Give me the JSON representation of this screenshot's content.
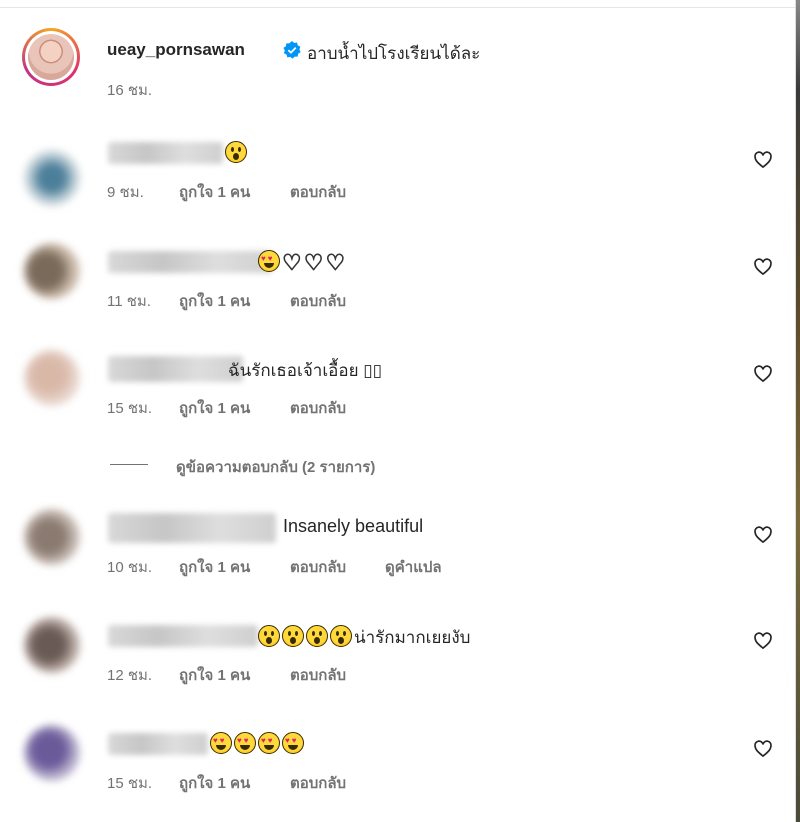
{
  "caption": {
    "username": "ueay_pornsawan",
    "text": "อาบน้ำไปโรงเรียนได้ละ",
    "time": "16 ชม."
  },
  "actions": {
    "like_count": "ถูกใจ 1 คน",
    "reply": "ตอบกลับ",
    "translate": "ดูคำแปล"
  },
  "comments": [
    {
      "text": "",
      "emoji": [
        "wow"
      ],
      "time": "9 ชม.",
      "likes": "ถูกใจ 1 คน"
    },
    {
      "text": "",
      "emoji": [
        "love",
        "white-heart",
        "white-heart",
        "white-heart"
      ],
      "time": "11 ชม.",
      "likes": "ถูกใจ 1 คน"
    },
    {
      "text": "ฉันรักเธอเจ้าเอื้อย ▯▯",
      "time": "15 ชม.",
      "likes": "ถูกใจ 1 คน"
    },
    {
      "text": "Insanely beautiful",
      "time": "10 ชม.",
      "likes": "ถูกใจ 1 คน",
      "translate": "ดูคำแปล"
    },
    {
      "text": "น่ารักมากเยยงับ",
      "emoji": [
        "wow",
        "wow",
        "wow",
        "wow"
      ],
      "time": "12 ชม.",
      "likes": "ถูกใจ 1 คน"
    },
    {
      "text": "",
      "emoji": [
        "love",
        "love",
        "love",
        "love"
      ],
      "time": "15 ชม.",
      "likes": "ถูกใจ 1 คน"
    }
  ],
  "view_replies": "ดูข้อความตอบกลับ (2 รายการ)",
  "colors": {
    "text": "#262626",
    "secondary": "#737373",
    "verified": "#0095f6"
  }
}
